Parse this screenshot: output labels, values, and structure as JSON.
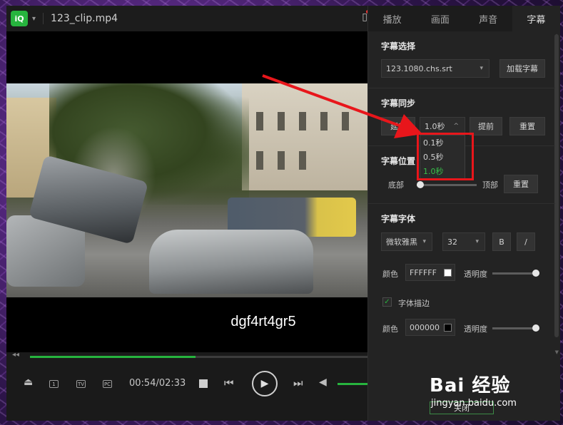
{
  "titlebar": {
    "logo_text": "iQ",
    "file_title": "123_clip.mp4"
  },
  "video": {
    "subtitle": "dgf4rt4gr5",
    "progress": 0.49
  },
  "controls": {
    "time": "00:54/02:33",
    "ctl_1": "1",
    "ctl_2": "TV",
    "ctl_3": "PC"
  },
  "panel": {
    "tabs": [
      "播放",
      "画面",
      "声音",
      "字幕"
    ],
    "active_tab": "字幕",
    "subtitle_select": {
      "title": "字幕选择",
      "file": "123.1080.chs.srt",
      "load_button": "加载字幕"
    },
    "subtitle_sync": {
      "title": "字幕同步",
      "delay_button": "延后",
      "step_value": "1.0秒",
      "advance_button": "提前",
      "reset_button": "重置",
      "options": [
        "0.1秒",
        "0.5秒",
        "1.0秒"
      ],
      "selected_option": "1.0秒"
    },
    "subtitle_position": {
      "title": "字幕位置",
      "left_label": "底部",
      "right_label": "顶部",
      "reset_button": "重置",
      "value": 0.0
    },
    "subtitle_font": {
      "title": "字幕字体",
      "font": "微软雅黑",
      "size": "32",
      "bold_label": "B",
      "italic_label": "/",
      "color_label": "颜色",
      "color_value": "FFFFFF",
      "opacity_label": "透明度",
      "opacity_value": 1.0,
      "outline_label": "字体描边",
      "outline_checked": true,
      "outline_color_label": "颜色",
      "outline_color_value": "000000",
      "outline_opacity_label": "透明度",
      "outline_opacity_value": 1.0
    },
    "bottom_button": "关闭"
  },
  "watermark": {
    "brand": "Bai 经验",
    "sub": "jingyan.baidu.com"
  },
  "colors": {
    "accent": "#27b43e",
    "highlight_box": "#e8161b",
    "arrow": "#e8161b"
  }
}
